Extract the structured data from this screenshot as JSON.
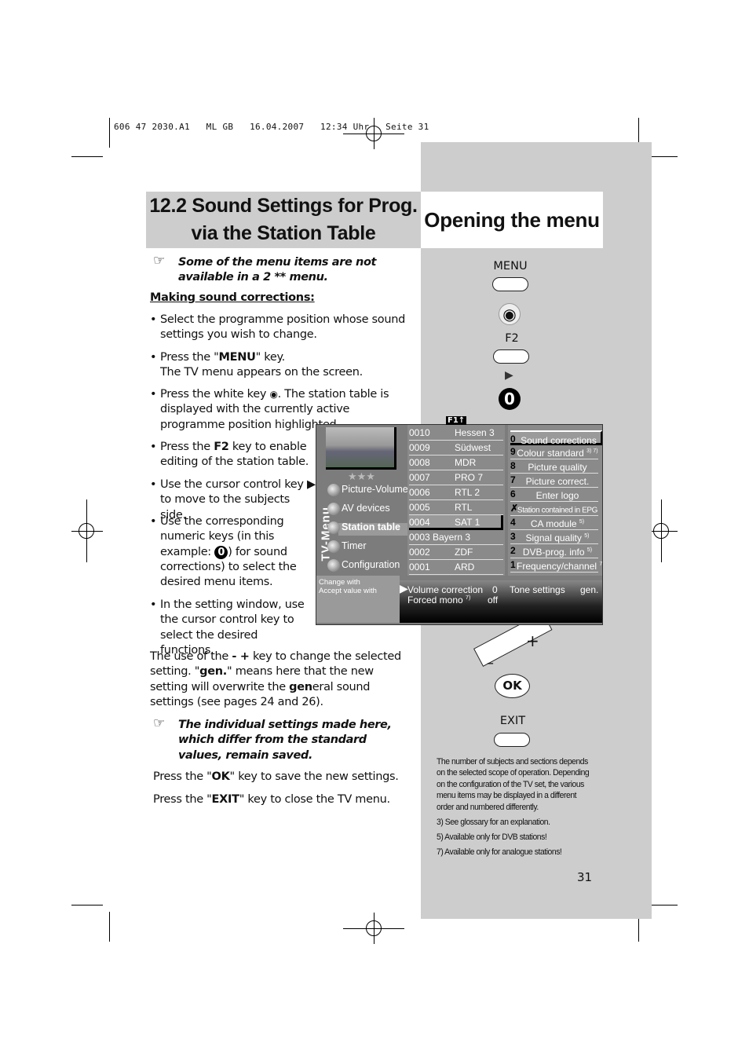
{
  "print_header": "606 47 2030.A1   ML GB   16.04.2007   12:34 Uhr   Seite 31",
  "title_left": [
    "12.2 Sound Settings for Prog.",
    "via the Station Table"
  ],
  "title_right": "Opening the menu",
  "note1": "Some of the menu items are not available in a 2 ** menu.",
  "section_heading": "Making sound corrections:",
  "bullets": {
    "b1": "Select the programme position whose sound settings you wish to change.",
    "b2a": "Press the \"",
    "b2b": "MENU",
    "b2c": "\" key.",
    "b2d": "The TV menu appears on the screen.",
    "b3a": "Press the white key ",
    "b3b": ". The station table is displayed with the currently active programme position highlighted.",
    "b4a": "Press the ",
    "b4b": "F2",
    "b4c": " key to enable editing of the station table.",
    "b5": "Use the cursor control key ▶ to move to the subjects side.",
    "b6a": "Use the corresponding numeric keys (in this example: ",
    "b6b": "0",
    "b6c": ") for sound corrections) to select the desired menu items.",
    "b7": "In the setting window, use the cursor control key to select the desired functions."
  },
  "para": {
    "a": "The use of the ",
    "b": "- +",
    "c": " key to change the selected setting. \"",
    "d": "gen.",
    "e": "\" means here that the new setting will overwrite the ",
    "f": "gen",
    "g": "eral sound settings (see pages 24 and 26)."
  },
  "note2": "The individual settings made here, which differ from the standard values, remain saved.",
  "ok_line": {
    "a": "Press the \"",
    "b": "OK",
    "c": "\" key to save the new settings."
  },
  "exit_line": {
    "a": "Press the \"",
    "b": "EXIT",
    "c": "\" key to close the TV menu."
  },
  "keys": {
    "menu": "MENU",
    "f2": "F2",
    "zero": "0",
    "plus": "+",
    "minus": "–",
    "ok": "OK",
    "exit": "EXIT"
  },
  "tv_menu": {
    "f1": "F1↑",
    "vertical": "TV-Menu",
    "stars": "★★★",
    "main_items": [
      "Picture-Volume",
      "AV devices",
      "Station table",
      "Timer",
      "Configuration"
    ],
    "stations": [
      [
        "0010",
        "Hessen 3"
      ],
      [
        "0009",
        "Südwest"
      ],
      [
        "0008",
        "MDR"
      ],
      [
        "0007",
        "PRO 7"
      ],
      [
        "0006",
        "RTL 2"
      ],
      [
        "0005",
        "RTL"
      ],
      [
        "0004",
        "SAT 1"
      ],
      [
        "0003",
        "Bayern 3"
      ],
      [
        "0002",
        "ZDF"
      ],
      [
        "0001",
        "ARD"
      ]
    ],
    "options": [
      [
        "0",
        "Sound corrections",
        ""
      ],
      [
        "9",
        "Colour standard",
        "3) 7)"
      ],
      [
        "8",
        "Picture quality",
        ""
      ],
      [
        "7",
        "Picture correct.",
        ""
      ],
      [
        "6",
        "Enter logo",
        ""
      ],
      [
        "✗",
        "Station contained in EPG",
        ""
      ],
      [
        "4",
        "CA module",
        "5)"
      ],
      [
        "3",
        "Signal quality",
        "5)"
      ],
      [
        "2",
        "DVB-prog. info",
        "5)"
      ],
      [
        "1",
        "Frequency/channel",
        "7)"
      ]
    ],
    "hint1": "Change with",
    "hint2": "Accept value with",
    "settings": {
      "volume_label": "Volume correction",
      "volume_value": "0",
      "tone_label": "Tone settings",
      "tone_value": "gen.",
      "mono_label": "Forced mono",
      "mono_sup": "7)",
      "mono_value": "off"
    }
  },
  "footnotes": [
    "The number of subjects and sections depends on the selected scope of operation. Depending on the configuration of the TV set, the various menu items may be displayed in a different order and numbered differently.",
    "3) See glossary for an explanation.",
    "5) Available only for DVB stations!",
    "7) Available only for analogue stations!"
  ],
  "page_number": "31"
}
